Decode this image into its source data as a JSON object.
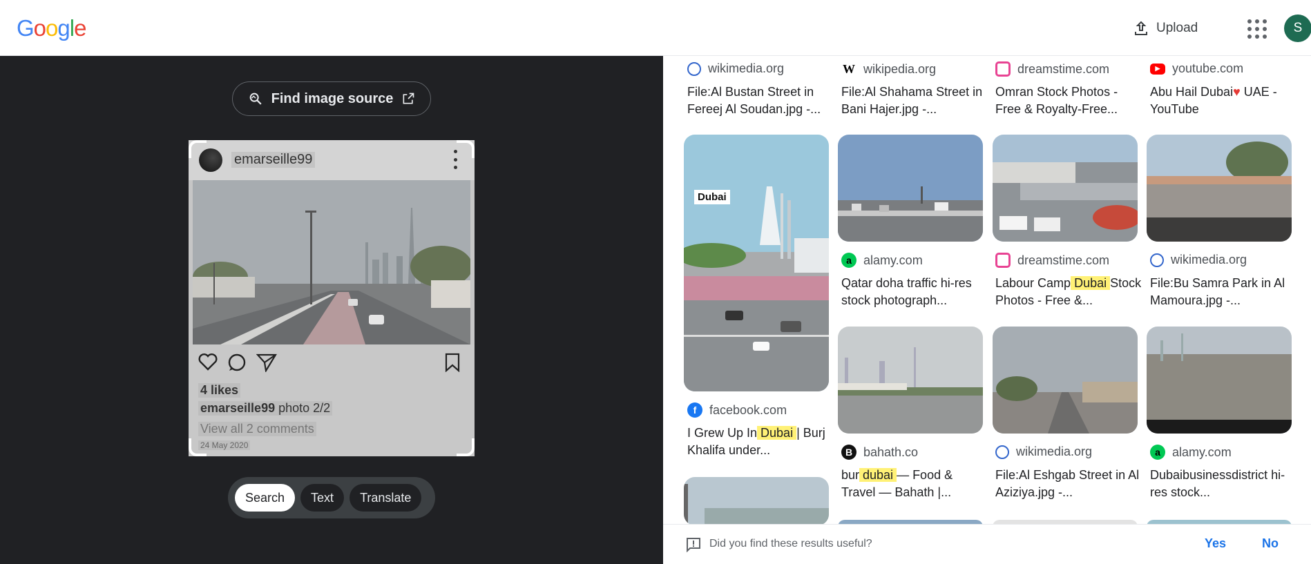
{
  "header": {
    "logo_text": "Google",
    "upload_label": "Upload",
    "avatar_initial": "S"
  },
  "left_panel": {
    "find_source_label": "Find image source",
    "preview": {
      "username": "emarseille99",
      "likes": "4 likes",
      "caption_user": "emarseille99",
      "caption_text": "photo 2/2",
      "view_comments": "View all 2 comments",
      "date": "24 May 2020"
    },
    "modes": [
      "Search",
      "Text",
      "Translate"
    ],
    "active_mode": "Search"
  },
  "results": [
    {
      "source": "wikimedia.org",
      "favicon": "wikimedia-icon",
      "title": "File:Al Bustan Street in Fereej Al Soudan.jpg -..."
    },
    {
      "source": "wikipedia.org",
      "favicon": "wikipedia-icon",
      "title": "File:Al Shahama Street in Bani Hajer.jpg -..."
    },
    {
      "source": "dreamstime.com",
      "favicon": "dreamstime-icon",
      "title": "Omran Stock Photos - Free & Royalty-Free..."
    },
    {
      "source": "youtube.com",
      "favicon": "youtube-icon",
      "title_parts": [
        "Abu Hail Dubai",
        "♥",
        " UAE - YouTube"
      ]
    },
    {
      "source": "facebook.com",
      "favicon": "facebook-icon",
      "title_parts": [
        "I Grew Up In",
        " Dubai ",
        "| Burj Khalifa under..."
      ],
      "badge": "Dubai"
    },
    {
      "source": "alamy.com",
      "favicon": "alamy-icon",
      "title": "Qatar doha traffic hi-res stock photograph..."
    },
    {
      "source": "dreamstime.com",
      "favicon": "dreamstime-icon",
      "title_parts": [
        "Labour Camp",
        " Dubai ",
        " Stock Photos - Free &..."
      ]
    },
    {
      "source": "wikimedia.org",
      "favicon": "wikimedia-icon",
      "title": "File:Bu Samra Park in Al Mamoura.jpg -..."
    },
    {
      "source": "bahath.co",
      "favicon": "bahath-icon",
      "title_parts": [
        "bur",
        " dubai ",
        "— Food & Travel — Bahath |..."
      ]
    },
    {
      "source": "wikimedia.org",
      "favicon": "wikimedia-icon",
      "title": "File:Al Eshgab Street in Al Aziziya.jpg -..."
    },
    {
      "source": "alamy.com",
      "favicon": "alamy-icon",
      "title": "Dubaibusinessdistrict hi-res stock..."
    }
  ],
  "feedback": {
    "question": "Did you find these results useful?",
    "yes": "Yes",
    "no": "No"
  },
  "colors": {
    "left_bg": "#202124",
    "link_blue": "#1a73e8",
    "highlight": "#fff176",
    "avatar_bg": "#1e6b52"
  }
}
